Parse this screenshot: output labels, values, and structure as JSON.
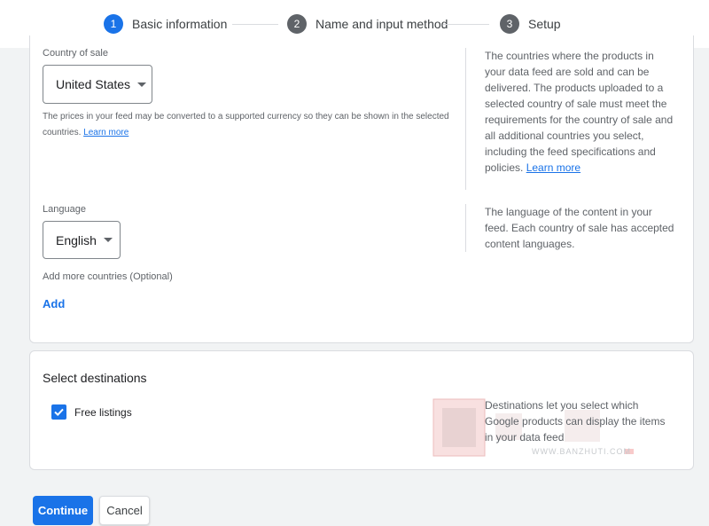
{
  "stepper": {
    "steps": [
      {
        "number": "1",
        "label": "Basic information"
      },
      {
        "number": "2",
        "label": "Name and input method"
      },
      {
        "number": "3",
        "label": "Setup"
      }
    ]
  },
  "country": {
    "label": "Country of sale",
    "value": "United States",
    "helper": "The prices in your feed may be converted to a supported currency so they can be shown in the selected countries.",
    "helper_link": "Learn more",
    "side_text": "The countries where the products in your data feed are sold and can be delivered. The products uploaded to a selected country of sale must meet the requirements for the country of sale and all additional countries you select, including the feed specifications and policies.",
    "side_link": "Learn more"
  },
  "language": {
    "label": "Language",
    "value": "English",
    "side_text": "The language of the content in your feed. Each country of sale has accepted content languages."
  },
  "more_countries": {
    "label": "Add more countries (Optional)",
    "add_label": "Add"
  },
  "destinations": {
    "title": "Select destinations",
    "checkbox_label": "Free listings",
    "checked": true,
    "side_text": "Destinations let you select which Google products can display the items in your data feed"
  },
  "watermark": {
    "text": "WWW.BANZHUTI.COM"
  },
  "buttons": {
    "continue": "Continue",
    "cancel": "Cancel"
  },
  "colors": {
    "accent": "#1a73e8",
    "step_inactive": "#5f6368"
  }
}
